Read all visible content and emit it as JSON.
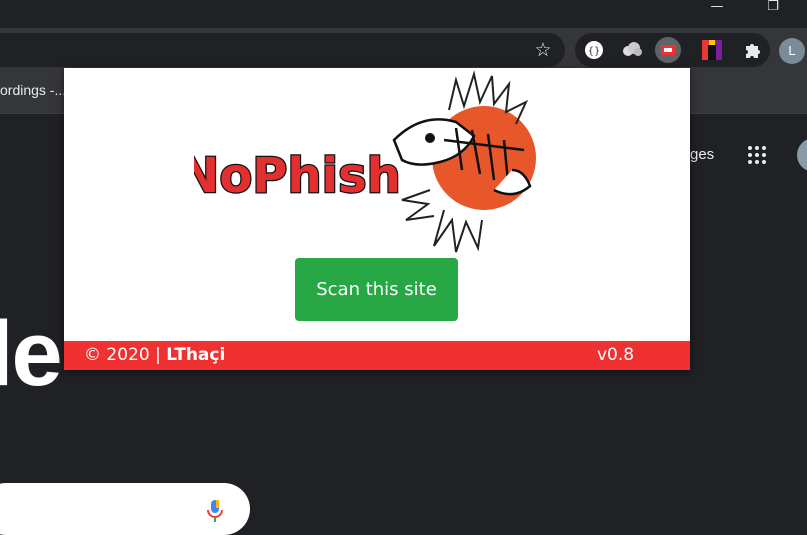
{
  "browser": {
    "bookmark_text": "ordings -...",
    "profile_initial": "L",
    "extensions": [
      "json-viewer-icon",
      "cloud-icon",
      "nophish-icon",
      "color-pick-icon",
      "puzzle-icon"
    ]
  },
  "page": {
    "right_text": "ges",
    "big_letters": "le"
  },
  "popup": {
    "logo_text": "NoPhish",
    "scan_button": "Scan this site",
    "copyright": "© 2020 | ",
    "author": "LThaçi",
    "version": "v0.8"
  },
  "colors": {
    "button": "#28a745",
    "footer": "#f03131",
    "logo_orange": "#e8572a"
  }
}
